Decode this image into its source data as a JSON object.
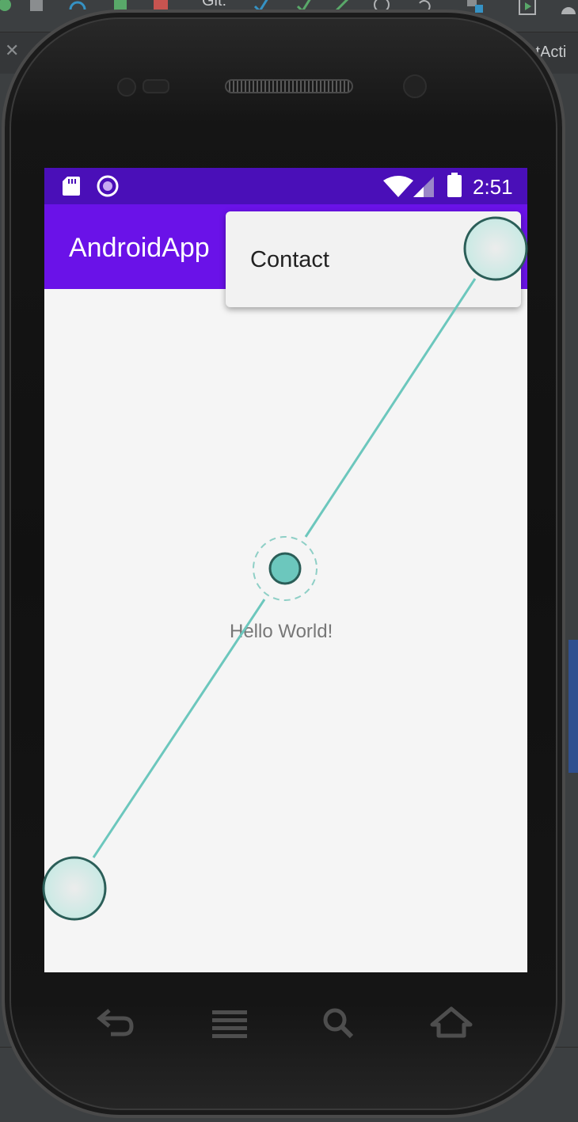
{
  "ide": {
    "git_label": "Git:",
    "tab_label": "istActi"
  },
  "app": {
    "title": "AndroidApp",
    "status_time": "2:51",
    "hello_text": "Hello World!"
  },
  "menu": {
    "items": [
      {
        "label": "Contact"
      }
    ]
  },
  "colors": {
    "status_bar": "#4a0fb8",
    "app_bar": "#6a12e8",
    "gesture_line": "#6cc7bd",
    "gesture_fill": "#d6ece8",
    "gesture_border": "#2b5e58"
  },
  "icons": [
    "sd-card-icon",
    "circle-notification-icon",
    "wifi-icon",
    "signal-icon",
    "battery-icon",
    "back-icon",
    "menu-icon",
    "search-icon",
    "home-icon"
  ]
}
